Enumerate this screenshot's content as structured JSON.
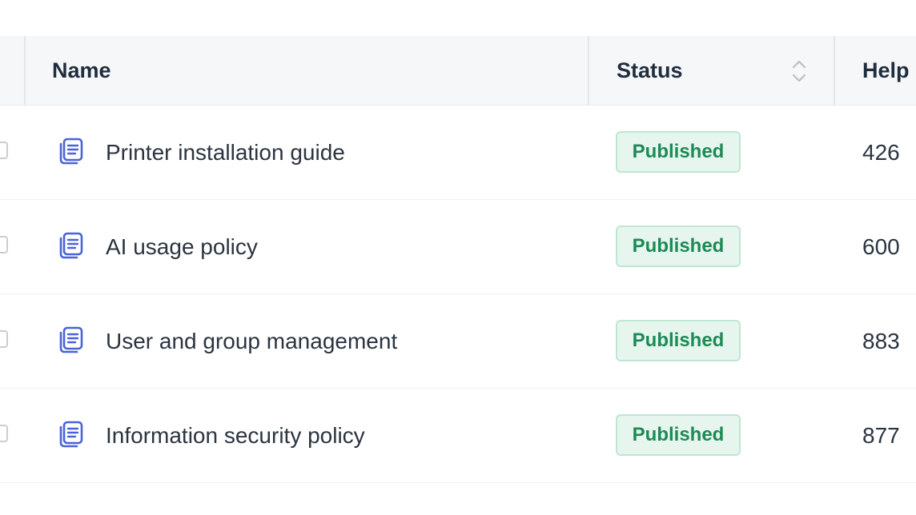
{
  "table": {
    "columns": {
      "name": "Name",
      "status": "Status",
      "helpful": "Help"
    },
    "rows": [
      {
        "name": "Printer installation guide",
        "status": "Published",
        "helpful": "426"
      },
      {
        "name": "AI usage policy",
        "status": "Published",
        "helpful": "600"
      },
      {
        "name": "User and group management",
        "status": "Published",
        "helpful": "883"
      },
      {
        "name": "Information security policy",
        "status": "Published",
        "helpful": "877"
      }
    ]
  },
  "icons": {
    "row_icon": "document-icon",
    "sort": "sort-updown-icon"
  },
  "colors": {
    "badge_bg": "#e6f6ef",
    "badge_text": "#1c8a55",
    "icon_blue": "#4a63d8",
    "header_bg": "#f5f7f9"
  }
}
